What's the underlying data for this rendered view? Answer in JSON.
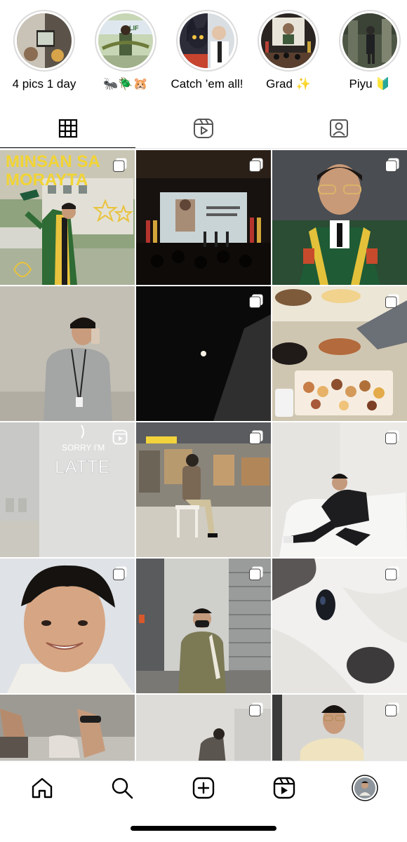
{
  "highlights": [
    {
      "label": "4 pics 1 day"
    },
    {
      "label": "🐜🪲🐹"
    },
    {
      "label": "Catch ’em all!"
    },
    {
      "label": "Grad ✨"
    },
    {
      "label": "Piyu 🔰"
    }
  ],
  "tabs": [
    {
      "icon": "grid-icon",
      "active": true
    },
    {
      "icon": "reels-icon",
      "active": false
    },
    {
      "icon": "tagged-icon",
      "active": false
    }
  ],
  "photo_text": {
    "banner_line1": "MINSAN SA",
    "banner_line2": "MORAYTA",
    "sign_line1": "SORRY I'M",
    "sign_line2": "LATTE"
  },
  "grid_posts": [
    {
      "desc": "graduation toga outdoors",
      "badge": "multi-photo"
    },
    {
      "desc": "graduation stage auditorium",
      "badge": "multi-photo"
    },
    {
      "desc": "graduation portrait",
      "badge": "multi-photo"
    },
    {
      "desc": "mirror selfie",
      "badge": "none"
    },
    {
      "desc": "night sky moon",
      "badge": "multi-photo"
    },
    {
      "desc": "food buffet",
      "badge": "multi-photo"
    },
    {
      "desc": "latte sign wall",
      "badge": "reel"
    },
    {
      "desc": "warehouse seated",
      "badge": "multi-photo"
    },
    {
      "desc": "white sofa pose",
      "badge": "multi-photo"
    },
    {
      "desc": "smiling selfie",
      "badge": "multi-photo"
    },
    {
      "desc": "masked standing",
      "badge": "multi-photo"
    },
    {
      "desc": "white rabbit closeup",
      "badge": "multi-photo"
    },
    {
      "desc": "feet sandals",
      "badge": "none"
    },
    {
      "desc": "grey wall",
      "badge": "multi-photo"
    },
    {
      "desc": "beige shirt",
      "badge": "multi-photo"
    }
  ],
  "bottom_nav": [
    {
      "icon": "home-icon"
    },
    {
      "icon": "search-icon"
    },
    {
      "icon": "create-icon"
    },
    {
      "icon": "reels-icon"
    },
    {
      "icon": "profile-avatar"
    }
  ],
  "colors": {
    "ring": "#dbdbdb",
    "active_tab": "#000000",
    "divider": "#e6e6e6"
  }
}
